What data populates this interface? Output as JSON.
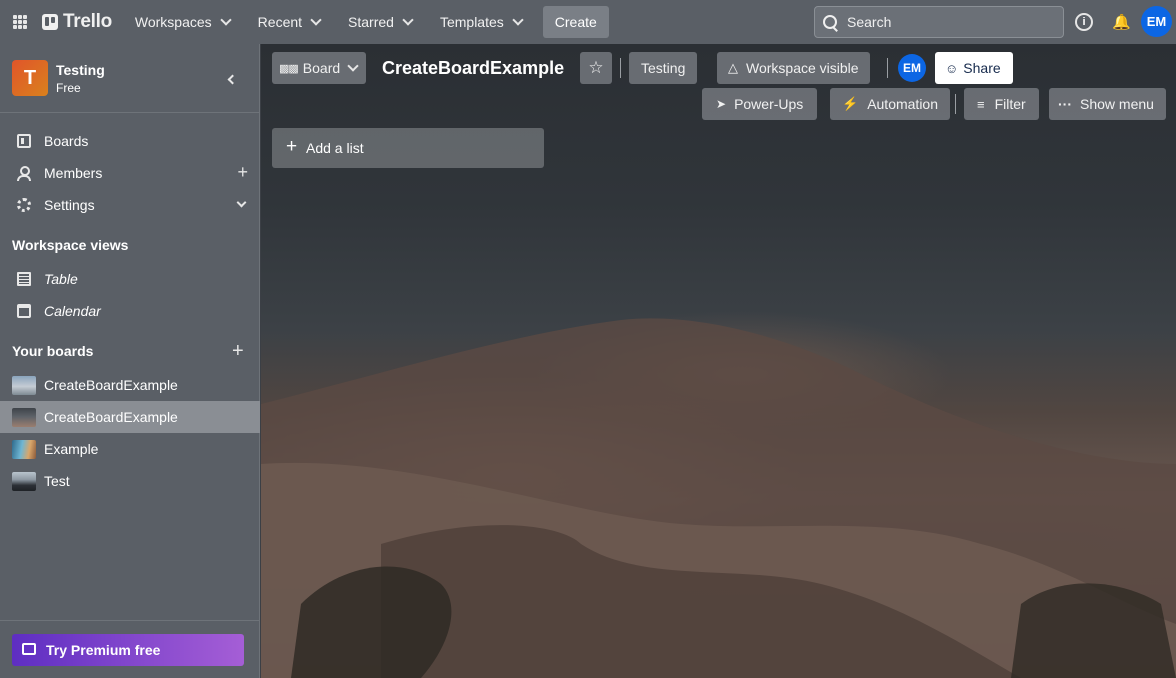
{
  "topbar": {
    "app_name": "Trello",
    "menus": [
      "Workspaces",
      "Recent",
      "Starred",
      "Templates"
    ],
    "create_label": "Create",
    "search_placeholder": "Search",
    "info_label": "i",
    "user_initials": "EM"
  },
  "sidebar": {
    "workspace_initial": "T",
    "workspace_name": "Testing",
    "workspace_plan": "Free",
    "nav": [
      "Boards",
      "Members",
      "Settings"
    ],
    "views_heading": "Workspace views",
    "views": [
      "Table",
      "Calendar"
    ],
    "boards_heading": "Your boards",
    "boards": [
      "CreateBoardExample",
      "CreateBoardExample",
      "Example",
      "Test"
    ],
    "premium_label": "Try Premium free"
  },
  "board": {
    "view_label": "Board",
    "title": "CreateBoardExample",
    "workspace_label": "Testing",
    "visibility_label": "Workspace visible",
    "member_initials": "EM",
    "share_label": "Share",
    "powerups_label": "Power-Ups",
    "automation_label": "Automation",
    "filter_label": "Filter",
    "menu_label": "Show menu",
    "add_list_label": "Add a list"
  },
  "colors": {
    "accent": "#0c66e4",
    "nav_bg": "#5a5f66",
    "premium_start": "#5e2ec2",
    "premium_end": "#a55ed6",
    "workspace_tile": "#e1552a"
  }
}
